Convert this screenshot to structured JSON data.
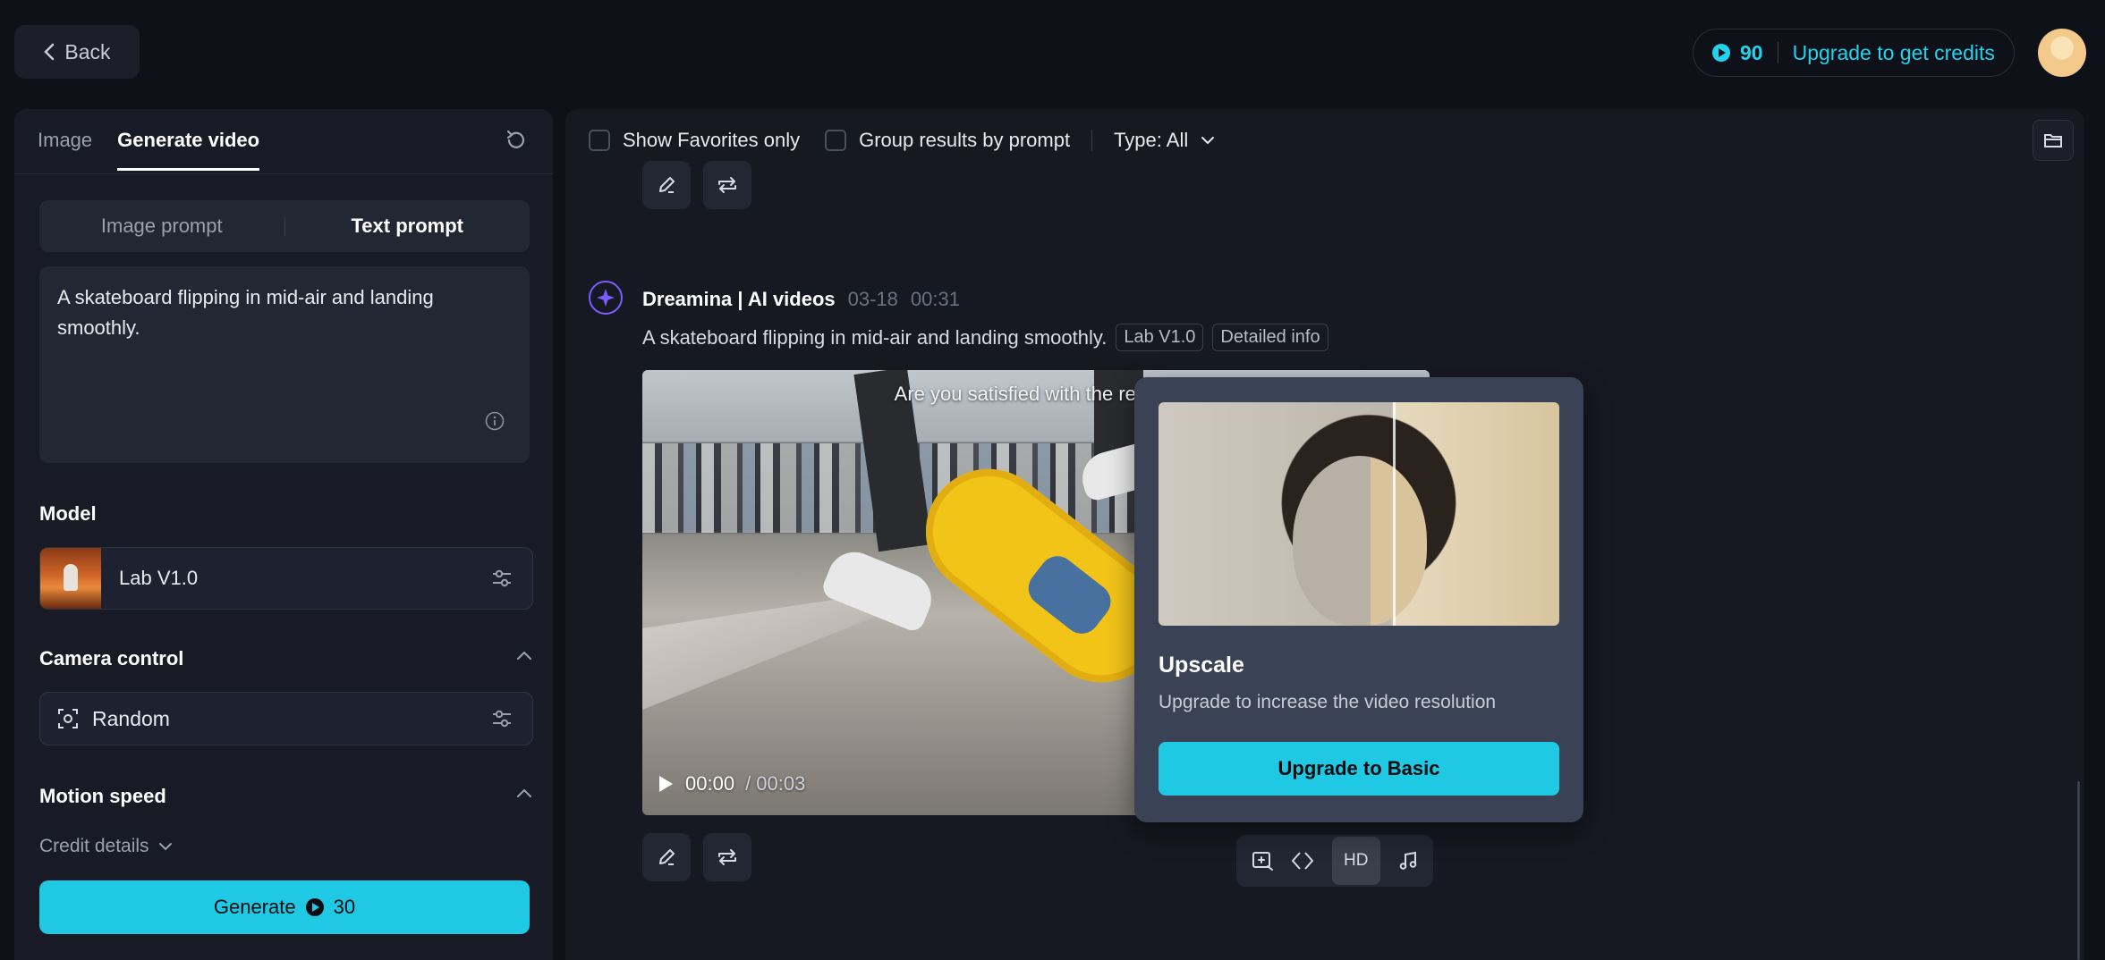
{
  "topbar": {
    "back_label": "Back",
    "credits": "90",
    "upgrade_label": "Upgrade to get credits"
  },
  "left": {
    "tabs": [
      {
        "label": "Image",
        "active": false
      },
      {
        "label": "Generate video",
        "active": true
      }
    ],
    "segment": {
      "image_prompt": "Image prompt",
      "text_prompt": "Text prompt"
    },
    "prompt_text": "A skateboard flipping in mid-air and landing smoothly.",
    "model_title": "Model",
    "model_name": "Lab V1.0",
    "camera_title": "Camera control",
    "camera_value": "Random",
    "motion_title": "Motion speed",
    "credit_details": "Credit details",
    "generate_label": "Generate",
    "generate_cost": "30"
  },
  "filters": {
    "favorites": "Show Favorites only",
    "group": "Group results by prompt",
    "type": "Type: All"
  },
  "result": {
    "author": "Dreamina | AI videos",
    "date": "03-18",
    "time": "00:31",
    "prompt": "A skateboard flipping in mid-air and landing smoothly.",
    "tag_model": "Lab V1.0",
    "tag_info": "Detailed info",
    "satisfied": "Are you satisfied with the result?",
    "current_time": "00:00",
    "duration": "/ 00:03",
    "hd_label": "HD"
  },
  "popover": {
    "title": "Upscale",
    "subtitle": "Upgrade to increase the video resolution",
    "button": "Upgrade to Basic"
  },
  "colors": {
    "accent": "#1fc8e3",
    "background": "#0f1119",
    "panel": "#181b25"
  }
}
